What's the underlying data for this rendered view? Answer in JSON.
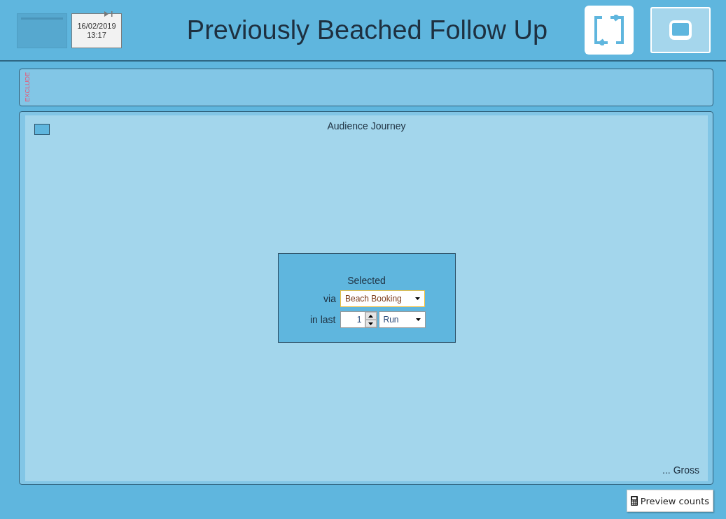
{
  "header": {
    "date": "16/02/2019",
    "time": "13:17",
    "title": "Previously Beached Follow Up"
  },
  "exclude": {
    "label": "EXCLUDE"
  },
  "journey": {
    "title": "Audience Journey",
    "node": {
      "heading": "Selected",
      "via_label": "via",
      "via_value": "Beach Booking",
      "in_last_label": "in last",
      "count": "1",
      "unit": "Run"
    },
    "footer": "... Gross"
  },
  "preview_button": {
    "label": "Preview counts"
  }
}
